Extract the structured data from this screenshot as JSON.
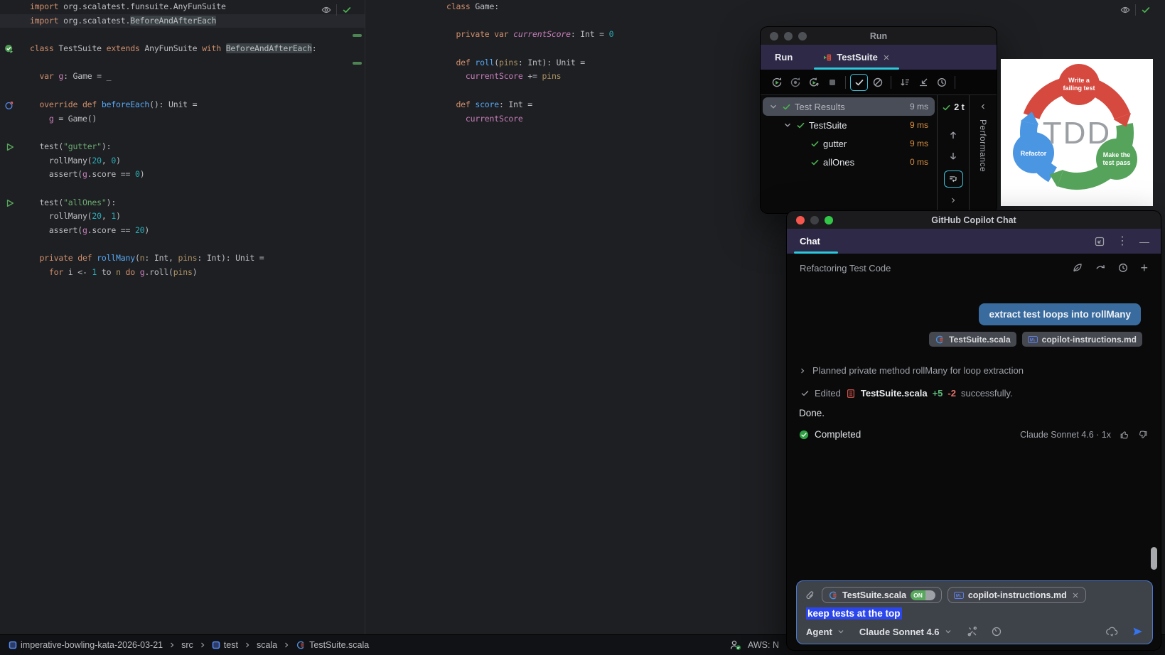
{
  "palette": {
    "kw": "#cf8e6d",
    "def": "#bcbec4",
    "fn": "#56a8f5",
    "str": "#6aab73",
    "num": "#2aacb8",
    "field": "#c77dbb",
    "param": "#ab9165",
    "box_bg": "#3b4245"
  },
  "accents": {
    "tab_underline": "#2bc9dd",
    "selection_blue": "#2b46ec",
    "bubble_blue": "#3a6b9e",
    "pass_green": "#4caf50",
    "duration_orange": "#d78f40",
    "send_blue": "#3574f0",
    "error_red": "#d6493f"
  },
  "editors": {
    "left": {
      "lines": [
        {
          "t": [
            [
              "kw",
              "import "
            ],
            [
              "def",
              "org.scalatest.funsuite.AnyFunSuite"
            ]
          ]
        },
        {
          "hl": true,
          "t": [
            [
              "kw",
              "import "
            ],
            [
              "def",
              "org.scalatest."
            ],
            [
              "box",
              "BeforeAndAfterEach"
            ]
          ]
        },
        {},
        {
          "t": [
            [
              "kw",
              "class "
            ],
            [
              "def",
              "TestSuite "
            ],
            [
              "kw",
              "extends "
            ],
            [
              "def",
              "AnyFunSuite "
            ],
            [
              "kw",
              "with "
            ],
            [
              "box",
              "BeforeAndAfterEach"
            ],
            [
              "def",
              ":"
            ]
          ]
        },
        {},
        {
          "t": [
            [
              "kw",
              "  var "
            ],
            [
              "field",
              "g"
            ],
            [
              "def",
              ": Game = _"
            ]
          ]
        },
        {},
        {
          "t": [
            [
              "kw",
              "  override def "
            ],
            [
              "fn",
              "beforeEach"
            ],
            [
              "def",
              "(): Unit ="
            ]
          ]
        },
        {
          "t": [
            [
              "def",
              "    "
            ],
            [
              "field",
              "g"
            ],
            [
              "def",
              " = Game()"
            ]
          ]
        },
        {},
        {
          "t": [
            [
              "def",
              "  test("
            ],
            [
              "str",
              "\"gutter\""
            ],
            [
              "def",
              "):"
            ]
          ]
        },
        {
          "t": [
            [
              "def",
              "    rollMany("
            ],
            [
              "num",
              "20"
            ],
            [
              "def",
              ", "
            ],
            [
              "num",
              "0"
            ],
            [
              "def",
              ")"
            ]
          ]
        },
        {
          "t": [
            [
              "def",
              "    assert("
            ],
            [
              "field",
              "g"
            ],
            [
              "def",
              ".score == "
            ],
            [
              "num",
              "0"
            ],
            [
              "def",
              ")"
            ]
          ]
        },
        {},
        {
          "t": [
            [
              "def",
              "  test("
            ],
            [
              "str",
              "\"allOnes\""
            ],
            [
              "def",
              "):"
            ]
          ]
        },
        {
          "t": [
            [
              "def",
              "    rollMany("
            ],
            [
              "num",
              "20"
            ],
            [
              "def",
              ", "
            ],
            [
              "num",
              "1"
            ],
            [
              "def",
              ")"
            ]
          ]
        },
        {
          "t": [
            [
              "def",
              "    assert("
            ],
            [
              "field",
              "g"
            ],
            [
              "def",
              ".score == "
            ],
            [
              "num",
              "20"
            ],
            [
              "def",
              ")"
            ]
          ]
        },
        {},
        {
          "t": [
            [
              "kw",
              "  private def "
            ],
            [
              "fn",
              "rollMany"
            ],
            [
              "def",
              "("
            ],
            [
              "param",
              "n"
            ],
            [
              "def",
              ": Int, "
            ],
            [
              "param",
              "pins"
            ],
            [
              "def",
              ": Int): Unit ="
            ]
          ]
        },
        {
          "t": [
            [
              "kw",
              "    for "
            ],
            [
              "def",
              "i <- "
            ],
            [
              "num",
              "1"
            ],
            [
              "def",
              " to "
            ],
            [
              "param",
              "n"
            ],
            [
              "kw",
              " do "
            ],
            [
              "field",
              "g"
            ],
            [
              "def",
              ".roll("
            ],
            [
              "param",
              "pins"
            ],
            [
              "def",
              ")"
            ]
          ]
        }
      ]
    },
    "mid": {
      "lines": [
        {
          "t": [
            [
              "kw",
              "class "
            ],
            [
              "def",
              "Game:"
            ]
          ]
        },
        {},
        {
          "t": [
            [
              "kw",
              "  private var "
            ],
            [
              "fielditalic",
              "currentScore"
            ],
            [
              "def",
              ": Int = "
            ],
            [
              "num",
              "0"
            ]
          ]
        },
        {},
        {
          "t": [
            [
              "kw",
              "  def "
            ],
            [
              "fn",
              "roll"
            ],
            [
              "def",
              "("
            ],
            [
              "param",
              "pins"
            ],
            [
              "def",
              ": Int): Unit ="
            ]
          ]
        },
        {
          "t": [
            [
              "def",
              "    "
            ],
            [
              "field",
              "currentScore"
            ],
            [
              "def",
              " += "
            ],
            [
              "param",
              "pins"
            ]
          ]
        },
        {},
        {
          "t": [
            [
              "kw",
              "  def "
            ],
            [
              "fn",
              "score"
            ],
            [
              "def",
              ": Int ="
            ]
          ]
        },
        {
          "t": [
            [
              "def",
              "    "
            ],
            [
              "field",
              "currentScore"
            ]
          ]
        }
      ]
    }
  },
  "run": {
    "window_title": "Run",
    "tool_label": "Run",
    "tab_label": "TestSuite",
    "summary": "2 t",
    "perf_tab": "Performance",
    "toolbar": [
      {
        "n": "rerun"
      },
      {
        "n": "resume"
      },
      {
        "n": "rerun-failed"
      },
      {
        "n": "stop"
      },
      {
        "n": "sep"
      },
      {
        "n": "show-passed",
        "active": true
      },
      {
        "n": "show-ignored"
      },
      {
        "n": "sep"
      },
      {
        "n": "sort-by-duration"
      },
      {
        "n": "import-test-results"
      },
      {
        "n": "test-history"
      },
      {
        "n": "sep"
      }
    ],
    "rows": [
      {
        "label": "Test Results",
        "dur": "9 ms",
        "level": 0,
        "chevron": true,
        "selected": true,
        "dur_color": "gray"
      },
      {
        "label": "TestSuite",
        "dur": "9 ms",
        "level": 1,
        "chevron": true,
        "dur_color": "orange"
      },
      {
        "label": "gutter",
        "dur": "9 ms",
        "level": 2,
        "dur_color": "orange"
      },
      {
        "label": "allOnes",
        "dur": "0 ms",
        "level": 2,
        "dur_color": "orange"
      }
    ]
  },
  "tdd": {
    "center": "TDD",
    "steps": [
      {
        "color": "#d6493f",
        "lines": [
          "Write a",
          "failing test"
        ]
      },
      {
        "color": "#56a45c",
        "lines": [
          "Make the",
          "test pass"
        ]
      },
      {
        "color": "#4b96e3",
        "lines": [
          "Refactor"
        ]
      }
    ]
  },
  "copilot": {
    "window_title": "GitHub Copilot Chat",
    "tab_label": "Chat",
    "thread_title": "Refactoring Test Code",
    "user_message": "extract test loops into rollMany",
    "attachments": [
      {
        "icon": "scala-file",
        "label": "TestSuite.scala"
      },
      {
        "icon": "md-file",
        "label": "copilot-instructions.md"
      }
    ],
    "planned": "Planned private method rollMany for loop extraction",
    "edited": {
      "prefix": "Edited",
      "file": "TestSuite.scala",
      "add": "+5",
      "del": "-2",
      "suffix": "successfully."
    },
    "done": "Done.",
    "completed_label": "Completed",
    "model_info": "Claude Sonnet 4.6 · 1x",
    "input": {
      "chips": [
        {
          "icon": "scala-file",
          "label": "TestSuite.scala",
          "toggle": "ON"
        },
        {
          "icon": "md-file",
          "label": "copilot-instructions.md",
          "close": true
        }
      ],
      "text": "keep tests at the top",
      "mode": "Agent",
      "model": "Claude Sonnet 4.6"
    }
  },
  "statusbar": {
    "breadcrumbs": [
      {
        "type": "module",
        "label": "imperative-bowling-kata-2026-03-21"
      },
      {
        "type": "plain",
        "label": "src"
      },
      {
        "type": "module",
        "label": "test"
      },
      {
        "type": "plain",
        "label": "scala"
      },
      {
        "type": "scala-file",
        "label": "TestSuite.scala"
      }
    ],
    "aws": "AWS: N"
  }
}
